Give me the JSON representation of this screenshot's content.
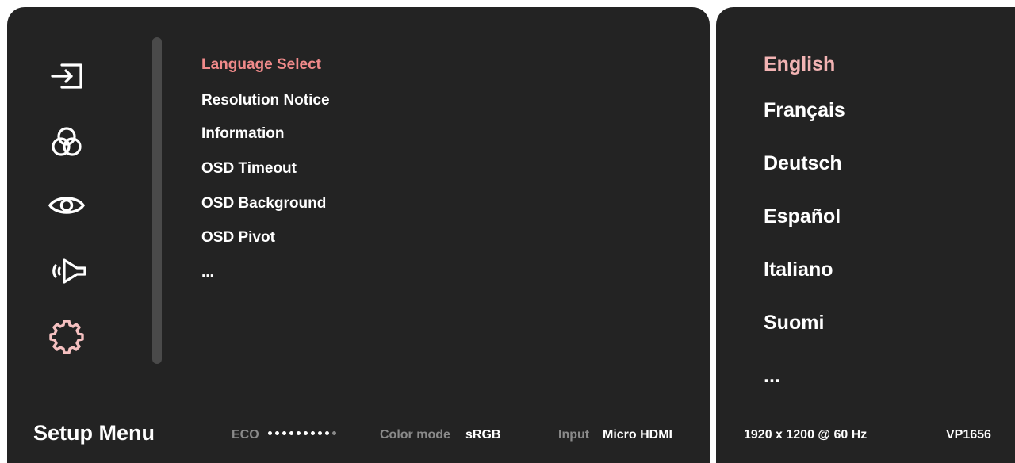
{
  "sidebar_icons": [
    {
      "name": "input-icon",
      "active": false
    },
    {
      "name": "color-icon",
      "active": false
    },
    {
      "name": "eye-icon",
      "active": false
    },
    {
      "name": "audio-icon",
      "active": false
    },
    {
      "name": "gear-icon",
      "active": true
    }
  ],
  "menu": {
    "items": [
      {
        "label": "Language Select",
        "active": true
      },
      {
        "label": "Resolution Notice",
        "active": false
      },
      {
        "label": "Information",
        "active": false
      },
      {
        "label": "OSD Timeout",
        "active": false
      },
      {
        "label": "OSD Background",
        "active": false
      },
      {
        "label": "OSD Pivot",
        "active": false
      },
      {
        "label": "...",
        "active": false
      }
    ]
  },
  "languages": {
    "items": [
      {
        "label": "English",
        "active": true
      },
      {
        "label": "Français",
        "active": false
      },
      {
        "label": "Deutsch",
        "active": false
      },
      {
        "label": "Español",
        "active": false
      },
      {
        "label": "Italiano",
        "active": false
      },
      {
        "label": "Suomi",
        "active": false
      },
      {
        "label": "...",
        "active": false
      }
    ]
  },
  "footer": {
    "title": "Setup Menu",
    "eco_label": "ECO",
    "eco_level_fraction": 0.9,
    "eco_dots_total": 10,
    "color_mode_label": "Color mode",
    "color_mode_value": "sRGB",
    "input_label": "Input",
    "input_value": "Micro HDMI",
    "resolution": "1920 x 1200 @ 60 Hz",
    "model": "VP1656"
  },
  "colors": {
    "panel_bg": "#232323",
    "accent_menu": "#f08a8a",
    "accent_lang": "#f2b3b3",
    "active_icon": "#f5c0c0"
  }
}
